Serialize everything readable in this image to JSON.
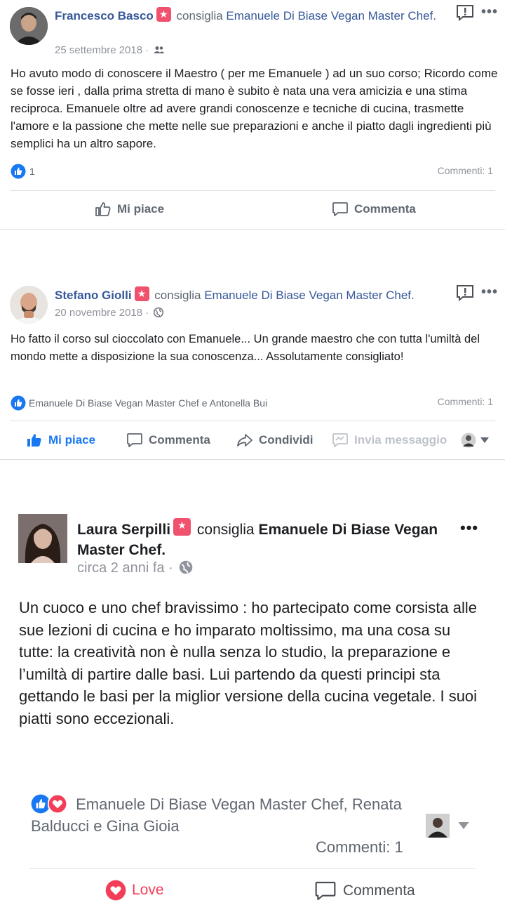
{
  "posts": [
    {
      "author": "Francesco Basco",
      "verb": "consiglia",
      "page": "Emanuele Di Biase Vegan Master Chef.",
      "date": "25 settembre 2018 ·",
      "audience_icon": "friends-icon",
      "body": "Ho avuto modo di conoscere il Maestro ( per me Emanuele ) ad un suo corso; Ricordo come se fosse ieri , dalla prima stretta di mano è subito è nata una vera amicizia e una stima reciproca. Emanuele oltre ad avere grandi conoscenze e tecniche di cucina, trasmette l'amore e la passione che mette nelle sue preparazioni e anche il piatto dagli ingredienti più semplici ha un altro sapore.",
      "reactions_count": "1",
      "comments": "Commenti: 1",
      "actions": {
        "like": "Mi piace",
        "comment": "Commenta"
      }
    },
    {
      "author": "Stefano Giolli",
      "verb": "consiglia",
      "page": "Emanuele Di Biase Vegan Master Chef.",
      "date": "20 novembre 2018 ·",
      "audience_icon": "globe-icon",
      "body": "Ho fatto il corso sul cioccolato con Emanuele... Un grande maestro che con tutta l'umiltà del mondo mette a disposizione la sua conoscenza... Assolutamente consigliato!",
      "reactions_text": "Emanuele Di Biase Vegan Master Chef e Antonella Bui",
      "comments": "Commenti: 1",
      "actions": {
        "like": "Mi piace",
        "comment": "Commenta",
        "share": "Condividi",
        "message": "Invia messaggio"
      }
    },
    {
      "author": "Laura Serpilli",
      "verb": "consiglia",
      "page": "Emanuele Di Biase Vegan Master Chef.",
      "date": "circa 2 anni fa ·",
      "audience_icon": "globe-icon",
      "body": "Un cuoco e uno chef bravissimo : ho partecipato come corsista alle sue lezioni di cucina e ho imparato moltissimo, ma una cosa su tutte: la creatività non è nulla senza lo studio, la preparazione e l’umiltà di partire dalle basi. Lui partendo da questi principi sta gettando le basi per la miglior versione della cucina vegetale. I suoi piatti sono eccezionali.",
      "reactions_text": "Emanuele Di Biase Vegan Master Chef, Renata Balducci e Gina Gioia",
      "comments": "Commenti: 1",
      "actions": {
        "love": "Love",
        "comment": "Commenta"
      }
    }
  ],
  "colors": {
    "link": "#365899",
    "like_blue": "#1877f2",
    "love_red": "#f33e58",
    "badge_pink": "#f0516d",
    "text_gray": "#606770"
  }
}
